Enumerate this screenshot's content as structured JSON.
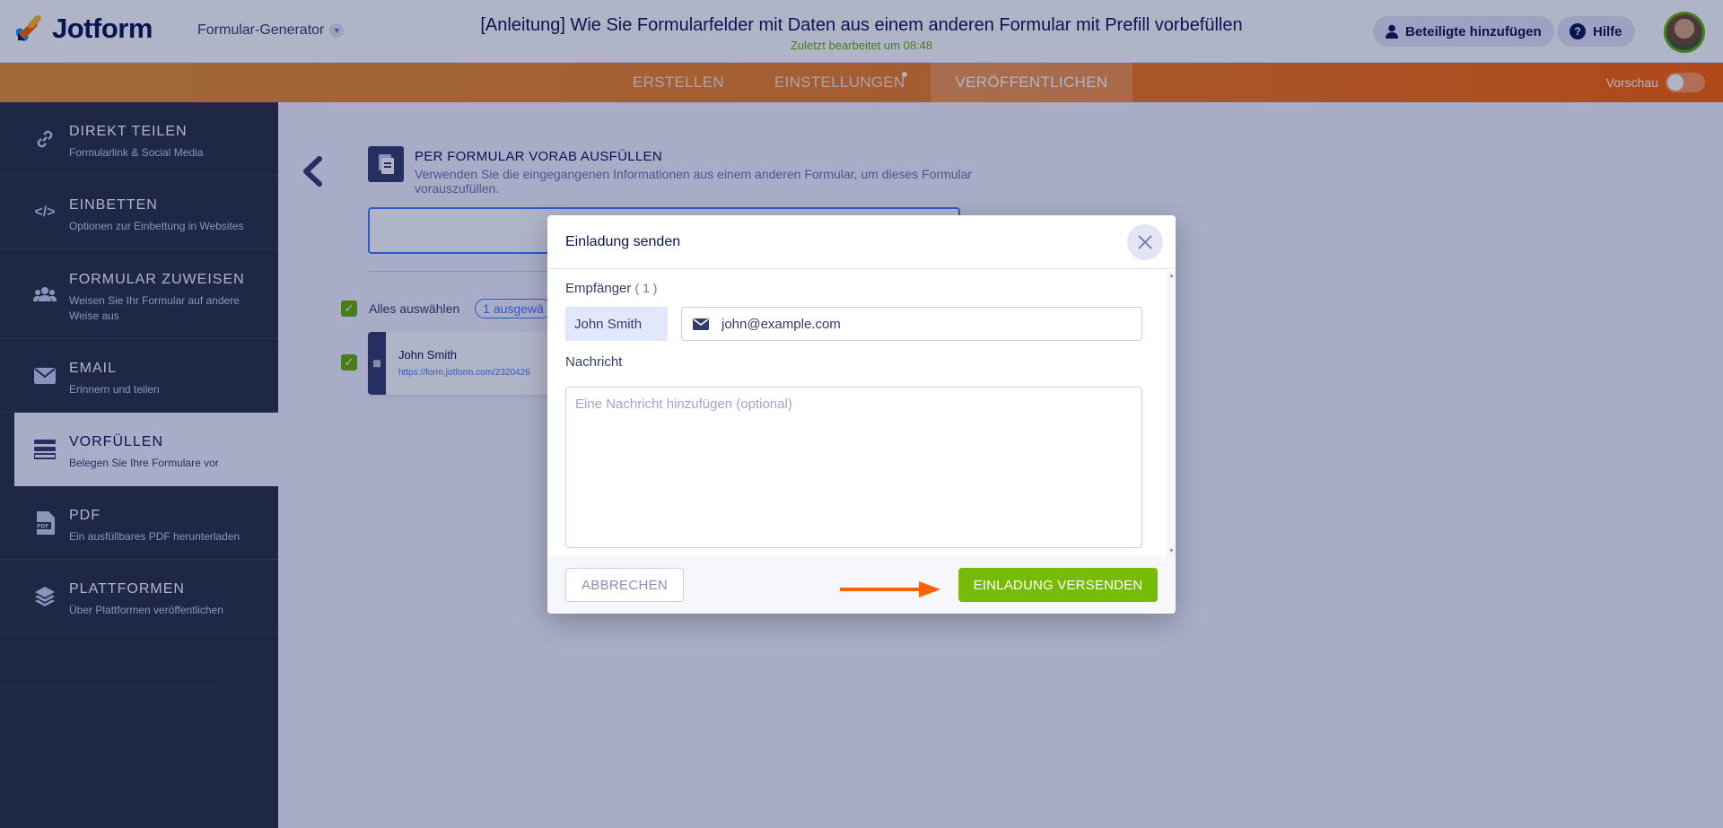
{
  "header": {
    "brand": "Jotform",
    "builder_selector": "Formular-Generator",
    "form_title": "[Anleitung] Wie Sie Formularfelder mit Daten aus einem anderen Formular mit Prefill vorbefüllen",
    "saved_status": "Zuletzt bearbeitet um 08:48",
    "add_collaborators": "Beteiligte hinzufügen",
    "help": "Hilfe"
  },
  "nav": {
    "tabs": [
      "ERSTELLEN",
      "EINSTELLUNGEN",
      "VERÖFFENTLICHEN"
    ],
    "active_tab": "VERÖFFENTLICHEN",
    "preview_label": "Vorschau"
  },
  "sidebar": {
    "items": [
      {
        "title": "DIREKT TEILEN",
        "subtitle": "Formularlink & Social Media",
        "icon": "link-icon"
      },
      {
        "title": "EINBETTEN",
        "subtitle": "Optionen zur Einbettung in Websites",
        "icon": "code-icon"
      },
      {
        "title": "FORMULAR ZUWEISEN",
        "subtitle": "Weisen Sie Ihr Formular auf andere Weise aus",
        "icon": "users-icon"
      },
      {
        "title": "EMAIL",
        "subtitle": "Erinnern und teilen",
        "icon": "envelope-icon"
      },
      {
        "title": "VORFÜLLEN",
        "subtitle": "Belegen Sie Ihre Formulare vor",
        "icon": "prefill-icon"
      },
      {
        "title": "PDF",
        "subtitle": "Ein ausfüllbares PDF herunterladen",
        "icon": "pdf-icon"
      },
      {
        "title": "PLATTFORMEN",
        "subtitle": "Über Plattformen veröffentlichen",
        "icon": "layers-icon"
      }
    ],
    "active": "VORFÜLLEN"
  },
  "main": {
    "title": "PER FORMULAR VORAB AUSFÜLLEN",
    "description": "Verwenden Sie die eingegangenen Informationen aus einem anderen Formular, um dieses Formular vorauszufüllen.",
    "select_all": "Alles auswählen",
    "selected_count": "1 ausgewä",
    "entry": {
      "name": "John Smith",
      "url": "https://form.jotform.com/2320426"
    }
  },
  "modal": {
    "title": "Einladung senden",
    "recipients_label": "Empfänger",
    "recipients_count": "( 1 )",
    "recipient_name": "John Smith",
    "recipient_email": "john@example.com",
    "message_label": "Nachricht",
    "message_placeholder": "Eine Nachricht hinzufügen (optional)",
    "cancel_label": "ABBRECHEN",
    "send_label": "EINLADUNG VERSENDEN"
  },
  "colors": {
    "accent_orange": "#ff6100",
    "send_green": "#78bb07",
    "sidebar_bg": "#293241",
    "saved_green": "#64b200"
  }
}
